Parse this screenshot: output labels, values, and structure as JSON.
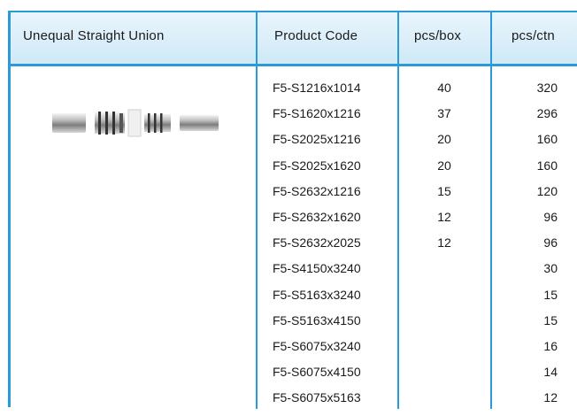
{
  "table": {
    "headers": {
      "product": "Unequal Straight Union",
      "code": "Product Code",
      "pcs_box": "pcs/box",
      "pcs_ctn": "pcs/ctn"
    },
    "product_image": "unequal-straight-union-fitting-photo",
    "rows": [
      {
        "code": "F5-S1216x1014",
        "pcs_box": "40",
        "pcs_ctn": "320"
      },
      {
        "code": "F5-S1620x1216",
        "pcs_box": "37",
        "pcs_ctn": "296"
      },
      {
        "code": "F5-S2025x1216",
        "pcs_box": "20",
        "pcs_ctn": "160"
      },
      {
        "code": "F5-S2025x1620",
        "pcs_box": "20",
        "pcs_ctn": "160"
      },
      {
        "code": "F5-S2632x1216",
        "pcs_box": "15",
        "pcs_ctn": "120"
      },
      {
        "code": "F5-S2632x1620",
        "pcs_box": "12",
        "pcs_ctn": "96"
      },
      {
        "code": "F5-S2632x2025",
        "pcs_box": "12",
        "pcs_ctn": "96"
      },
      {
        "code": "F5-S4150x3240",
        "pcs_box": "",
        "pcs_ctn": "30"
      },
      {
        "code": "F5-S5163x3240",
        "pcs_box": "",
        "pcs_ctn": "15"
      },
      {
        "code": "F5-S5163x4150",
        "pcs_box": "",
        "pcs_ctn": "15"
      },
      {
        "code": "F5-S6075x3240",
        "pcs_box": "",
        "pcs_ctn": "16"
      },
      {
        "code": "F5-S6075x4150",
        "pcs_box": "",
        "pcs_ctn": "14"
      },
      {
        "code": "F5-S6075x5163",
        "pcs_box": "",
        "pcs_ctn": "12"
      }
    ]
  },
  "colors": {
    "border": "#2a9ad8",
    "header_bg": "#d6edf9"
  }
}
